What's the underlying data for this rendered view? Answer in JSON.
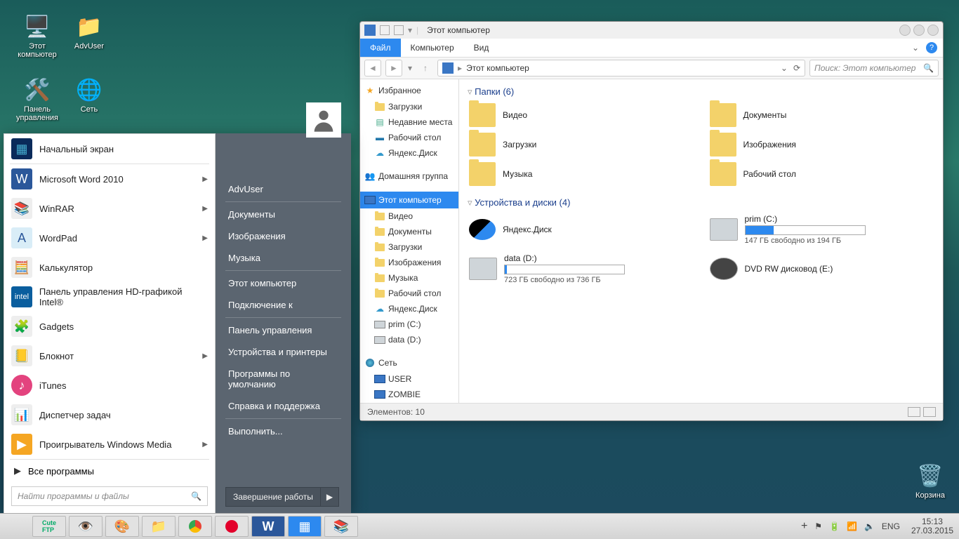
{
  "desktop": {
    "icons": [
      {
        "label": "Этот компьютер"
      },
      {
        "label": "AdvUser"
      },
      {
        "label": "Панель управления"
      },
      {
        "label": "Сеть"
      },
      {
        "label": "Корзина"
      }
    ]
  },
  "explorer": {
    "title": "Этот компьютер",
    "tabs": {
      "file": "Файл",
      "computer": "Компьютер",
      "view": "Вид"
    },
    "breadcrumb": "Этот компьютер",
    "search_placeholder": "Поиск: Этот компьютер",
    "nav": {
      "favorites": "Избранное",
      "fav_items": [
        {
          "label": "Загрузки"
        },
        {
          "label": "Недавние места"
        },
        {
          "label": "Рабочий стол"
        },
        {
          "label": "Яндекс.Диск"
        }
      ],
      "homegroup": "Домашняя группа",
      "this_pc": "Этот компьютер",
      "pc_items": [
        {
          "label": "Видео"
        },
        {
          "label": "Документы"
        },
        {
          "label": "Загрузки"
        },
        {
          "label": "Изображения"
        },
        {
          "label": "Музыка"
        },
        {
          "label": "Рабочий стол"
        },
        {
          "label": "Яндекс.Диск"
        },
        {
          "label": "prim (C:)"
        },
        {
          "label": "data (D:)"
        }
      ],
      "network": "Сеть",
      "net_items": [
        {
          "label": "USER"
        },
        {
          "label": "ZOMBIE"
        }
      ]
    },
    "content": {
      "folders_header": "Папки (6)",
      "folders": [
        {
          "label": "Видео"
        },
        {
          "label": "Документы"
        },
        {
          "label": "Загрузки"
        },
        {
          "label": "Изображения"
        },
        {
          "label": "Музыка"
        },
        {
          "label": "Рабочий стол"
        }
      ],
      "drives_header": "Устройства и диски (4)",
      "yandex": {
        "label": "Яндекс.Диск"
      },
      "prim": {
        "label": "prim (C:)",
        "free": "147 ГБ свободно из 194 ГБ",
        "pct": 24
      },
      "data": {
        "label": "data (D:)",
        "free": "723 ГБ свободно из 736 ГБ",
        "pct": 2
      },
      "dvd": {
        "label": "DVD RW дисковод (E:)"
      }
    },
    "status": "Элементов: 10"
  },
  "start": {
    "programs": [
      {
        "label": "Начальный экран",
        "arrow": false
      },
      {
        "label": "Microsoft Word 2010",
        "arrow": true
      },
      {
        "label": "WinRAR",
        "arrow": true
      },
      {
        "label": "WordPad",
        "arrow": true
      },
      {
        "label": "Калькулятор",
        "arrow": false
      },
      {
        "label": "Панель управления HD-графикой Intel®",
        "arrow": false
      },
      {
        "label": "Gadgets",
        "arrow": false
      },
      {
        "label": "Блокнот",
        "arrow": true
      },
      {
        "label": "iTunes",
        "arrow": false
      },
      {
        "label": "Диспетчер задач",
        "arrow": false
      },
      {
        "label": "Проигрыватель Windows Media",
        "arrow": true
      }
    ],
    "all_programs": "Все программы",
    "search_placeholder": "Найти программы и файлы",
    "right": [
      "AdvUser",
      "Документы",
      "Изображения",
      "Музыка",
      "Этот компьютер",
      "Подключение к",
      "Панель управления",
      "Устройства и принтеры",
      "Программы по умолчанию",
      "Справка и поддержка",
      "Выполнить..."
    ],
    "shutdown": "Завершение работы"
  },
  "taskbar": {
    "lang": "ENG",
    "time": "15:13",
    "date": "27.03.2015"
  }
}
